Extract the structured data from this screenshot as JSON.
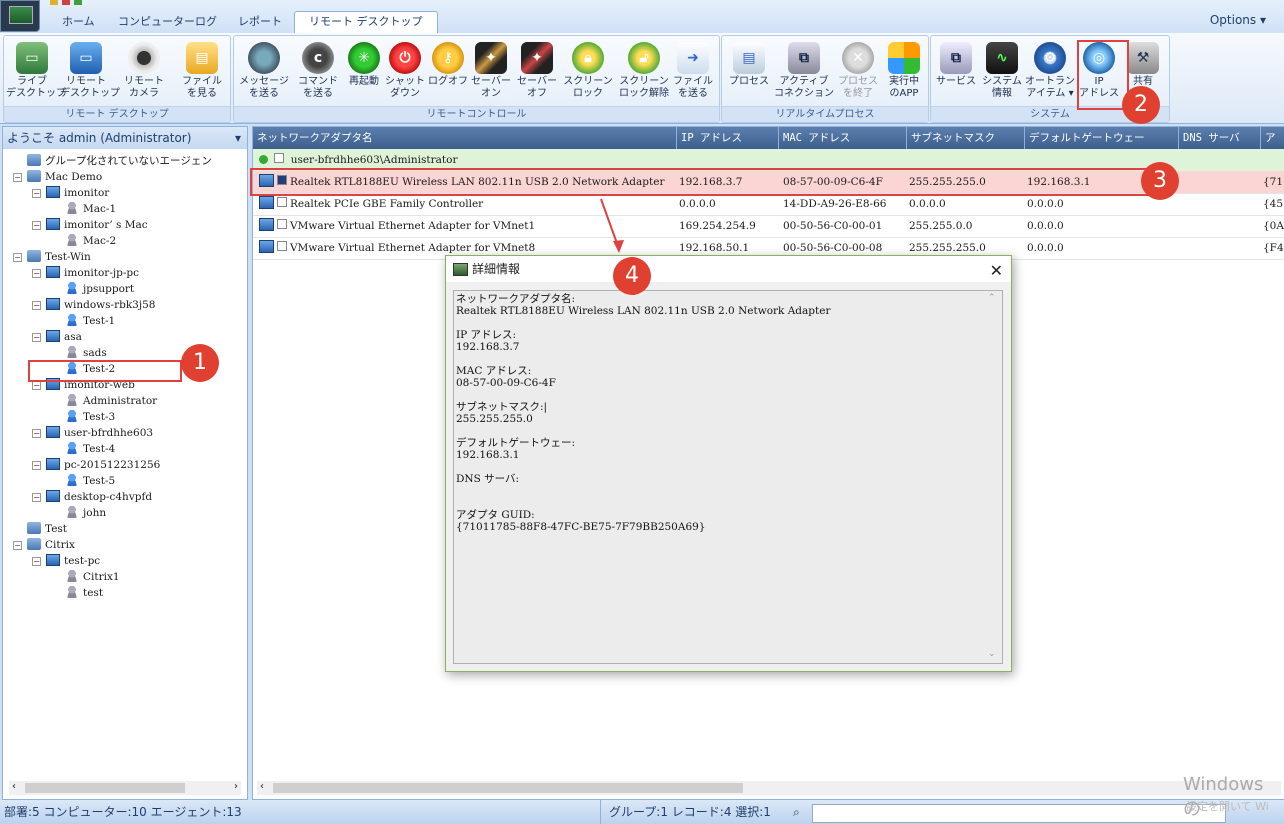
{
  "tabs": [
    "ホーム",
    "コンピューターログ",
    "レポート",
    "リモート デスクトップ"
  ],
  "active_tab": 3,
  "options_label": "Options ▾",
  "ribbon": {
    "groups": [
      {
        "label": "リモート デスクトップ",
        "buttons": [
          {
            "label": "ライブ\nデスクトップ",
            "icon": "monitor-icon"
          },
          {
            "label": "リモート\nデスクトップ",
            "icon": "desktop-icon"
          },
          {
            "label": "リモート\nカメラ",
            "icon": "camera-icon"
          },
          {
            "label": "ファイル\nを見る",
            "icon": "folder-icon"
          }
        ]
      },
      {
        "label": "リモートコントロール",
        "buttons": [
          {
            "label": "メッセージ\nを送る",
            "icon": "message-icon"
          },
          {
            "label": "コマンド\nを送る",
            "icon": "command-icon"
          },
          {
            "label": "再起動",
            "icon": "restart-icon"
          },
          {
            "label": "シャット\nダウン",
            "icon": "power-icon"
          },
          {
            "label": "ログオフ",
            "icon": "logoff-key-icon"
          },
          {
            "label": "セーバー\nオン",
            "icon": "screensaver-on-icon"
          },
          {
            "label": "セーバー\nオフ",
            "icon": "screensaver-off-icon"
          },
          {
            "label": "スクリーン\nロック",
            "icon": "screen-lock-icon"
          },
          {
            "label": "スクリーン\nロック解除",
            "icon": "screen-unlock-icon"
          },
          {
            "label": "ファイル\nを送る",
            "icon": "send-file-icon"
          }
        ]
      },
      {
        "label": "リアルタイムプロセス",
        "buttons": [
          {
            "label": "プロセス",
            "icon": "process-icon"
          },
          {
            "label": "アクティブ\nコネクション",
            "icon": "connection-icon"
          },
          {
            "label": "プロセス\nを終了",
            "icon": "kill-process-icon"
          },
          {
            "label": "実行中\nのAPP",
            "icon": "running-apps-icon"
          }
        ]
      },
      {
        "label": "システム",
        "buttons": [
          {
            "label": "サービス",
            "icon": "services-icon"
          },
          {
            "label": "システム\n情報",
            "icon": "system-info-icon"
          },
          {
            "label": "オートラン\nアイテム ▾",
            "icon": "autorun-gear-icon"
          },
          {
            "label": "IP\nアドレス",
            "icon": "ip-address-icon"
          },
          {
            "label": "共有",
            "icon": "share-icon"
          }
        ]
      }
    ]
  },
  "left_panel": {
    "header": "ようこそ admin (Administrator)",
    "tree": [
      {
        "label": "グループ化されていないエージェン",
        "level": 0,
        "type": "group"
      },
      {
        "label": "Mac Demo",
        "level": 0,
        "type": "group"
      },
      {
        "label": "imonitor",
        "level": 1,
        "type": "pc"
      },
      {
        "label": "Mac-1",
        "level": 2,
        "type": "user-gray"
      },
      {
        "label": "imonitor’ s Mac",
        "level": 1,
        "type": "pc"
      },
      {
        "label": "Mac-2",
        "level": 2,
        "type": "user-gray"
      },
      {
        "label": "Test-Win",
        "level": 0,
        "type": "group"
      },
      {
        "label": "imonitor-jp-pc",
        "level": 1,
        "type": "pc"
      },
      {
        "label": "jpsupport",
        "level": 2,
        "type": "user"
      },
      {
        "label": "windows-rbk3j58",
        "level": 1,
        "type": "pc"
      },
      {
        "label": "Test-1",
        "level": 2,
        "type": "user"
      },
      {
        "label": "asa",
        "level": 1,
        "type": "pc"
      },
      {
        "label": "sads",
        "level": 2,
        "type": "user-gray"
      },
      {
        "label": "Test-2",
        "level": 2,
        "type": "user"
      },
      {
        "label": "imonitor-web",
        "level": 1,
        "type": "pc"
      },
      {
        "label": "Administrator",
        "level": 2,
        "type": "user-gray"
      },
      {
        "label": "Test-3",
        "level": 2,
        "type": "user"
      },
      {
        "label": "user-bfrdhhe603",
        "level": 1,
        "type": "pc"
      },
      {
        "label": "Test-4",
        "level": 2,
        "type": "user"
      },
      {
        "label": "pc-201512231256",
        "level": 1,
        "type": "pc"
      },
      {
        "label": "Test-5",
        "level": 2,
        "type": "user"
      },
      {
        "label": "desktop-c4hvpfd",
        "level": 1,
        "type": "pc"
      },
      {
        "label": "john",
        "level": 2,
        "type": "user-gray"
      },
      {
        "label": "Test",
        "level": 0,
        "type": "group"
      },
      {
        "label": "Citrix",
        "level": 0,
        "type": "group"
      },
      {
        "label": "test-pc",
        "level": 1,
        "type": "pc"
      },
      {
        "label": "Citrix1",
        "level": 2,
        "type": "user-gray"
      },
      {
        "label": "test",
        "level": 2,
        "type": "user-gray"
      }
    ]
  },
  "table": {
    "columns": [
      "ネットワークアダプタ名",
      "IP アドレス",
      "MAC アドレス",
      "サブネットマスク",
      "デフォルトゲートウェー",
      "DNS サーバ",
      "ア"
    ],
    "group_row": "user-bfrdhhe603\\Administrator",
    "rows": [
      {
        "name": "Realtek RTL8188EU Wireless LAN 802.11n USB 2.0 Network Adapter",
        "ip": "192.168.3.7",
        "mac": "08-57-00-09-C6-4F",
        "mask": "255.255.255.0",
        "gw": "192.168.3.1",
        "dns": "",
        "extra": "{71",
        "selected": true
      },
      {
        "name": "Realtek PCIe GBE Family Controller",
        "ip": "0.0.0.0",
        "mac": "14-DD-A9-26-E8-66",
        "mask": "0.0.0.0",
        "gw": "0.0.0.0",
        "dns": "",
        "extra": "{45",
        "selected": false
      },
      {
        "name": "VMware Virtual Ethernet Adapter for VMnet1",
        "ip": "169.254.254.9",
        "mac": "00-50-56-C0-00-01",
        "mask": "255.255.0.0",
        "gw": "0.0.0.0",
        "dns": "",
        "extra": "{0A",
        "selected": false
      },
      {
        "name": "VMware Virtual Ethernet Adapter for VMnet8",
        "ip": "192.168.50.1",
        "mac": "00-50-56-C0-00-08",
        "mask": "255.255.255.0",
        "gw": "0.0.0.0",
        "dns": "",
        "extra": "{F4",
        "selected": false
      }
    ]
  },
  "dialog": {
    "title": "詳細情報",
    "close": "✕",
    "content": "ネットワークアダプタ名:\nRealtek RTL8188EU Wireless LAN 802.11n USB 2.0 Network Adapter\n\nIP アドレス:\n192.168.3.7\n\nMAC アドレス:\n08-57-00-09-C6-4F\n\nサブネットマスク:|\n255.255.255.0\n\nデフォルトゲートウェー:\n192.168.3.1\n\nDNS サーバ:\n\n\nアダプタ GUID:\n{71011785-88F8-47FC-BE75-7F79BB250A69}"
  },
  "callouts": [
    "1",
    "2",
    "3",
    "4"
  ],
  "status": {
    "left": "部署:5 コンピューター:10 エージェント:13",
    "right": "グループ:1 レコード:4 選択:1"
  },
  "watermark": {
    "line1": "Windows の",
    "line2": "設定を開いて Wi"
  },
  "colors": {
    "accent": "#3e5f8e",
    "highlight_red": "#e04040",
    "selected_row": "#fbd4d4",
    "group_row": "#dff3d9"
  }
}
